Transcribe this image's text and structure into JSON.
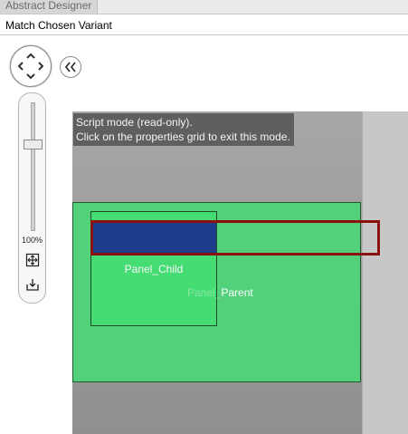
{
  "app": {
    "tab_label": "Abstract Designer"
  },
  "variant_bar": {
    "label": "Match Chosen Variant"
  },
  "zoom": {
    "label": "100%",
    "level_percent": 100
  },
  "script_mode": {
    "line1": "Script mode (read-only).",
    "line2": "Click on the properties grid to exit this mode."
  },
  "panels": {
    "child_label": "Panel_Child",
    "parent_label_prefix": "Panel_",
    "parent_label_suffix": "Parent"
  },
  "colors": {
    "parent_fill": "#52d07a",
    "child_fill": "#45dc74",
    "selected_fill": "#1e3d8a",
    "selection_border": "#8b1010"
  },
  "icons": {
    "pan": "pan-arrows-icon",
    "collapse": "double-chevron-left-icon",
    "fit": "fit-to-screen-icon",
    "export": "download-icon"
  }
}
